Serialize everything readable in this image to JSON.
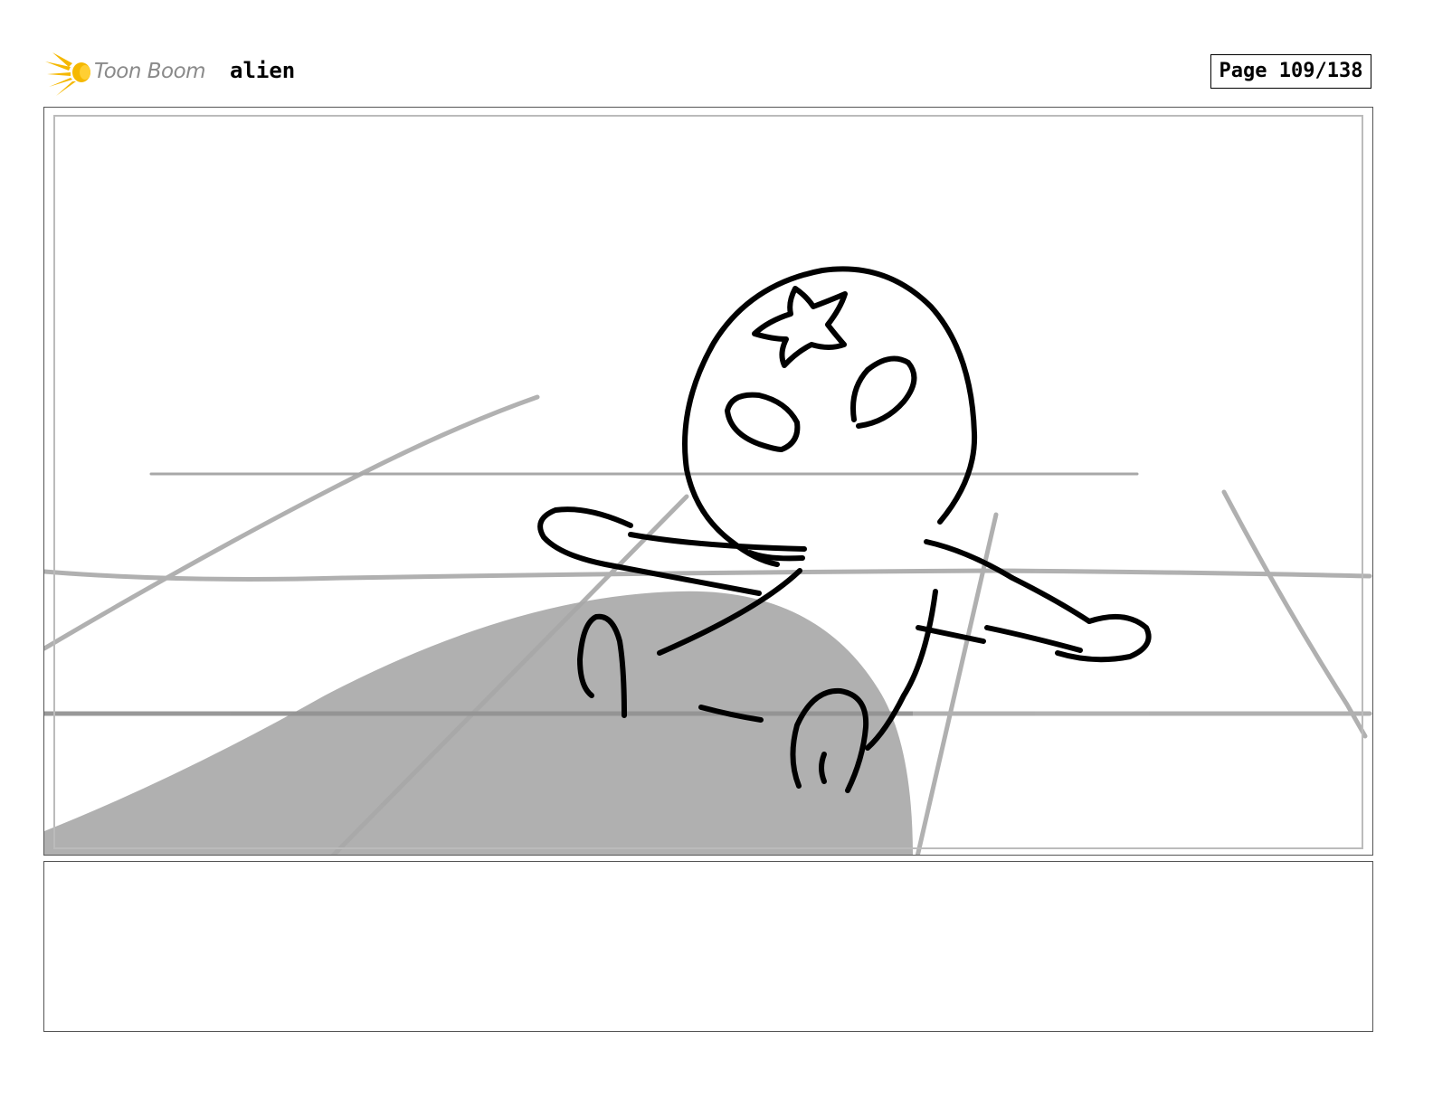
{
  "header": {
    "logo_text": "Toon Boom",
    "project_title": "alien",
    "page_indicator": "Page 109/138"
  },
  "panel": {
    "image_description_icon": "storyboard-sketch-alien-character"
  },
  "caption": {
    "text": ""
  },
  "colors": {
    "logo_yellow": "#f5b800",
    "logo_gray": "#8a8a8a",
    "sketch_gray": "#a8a8a8",
    "ink": "#000000"
  }
}
